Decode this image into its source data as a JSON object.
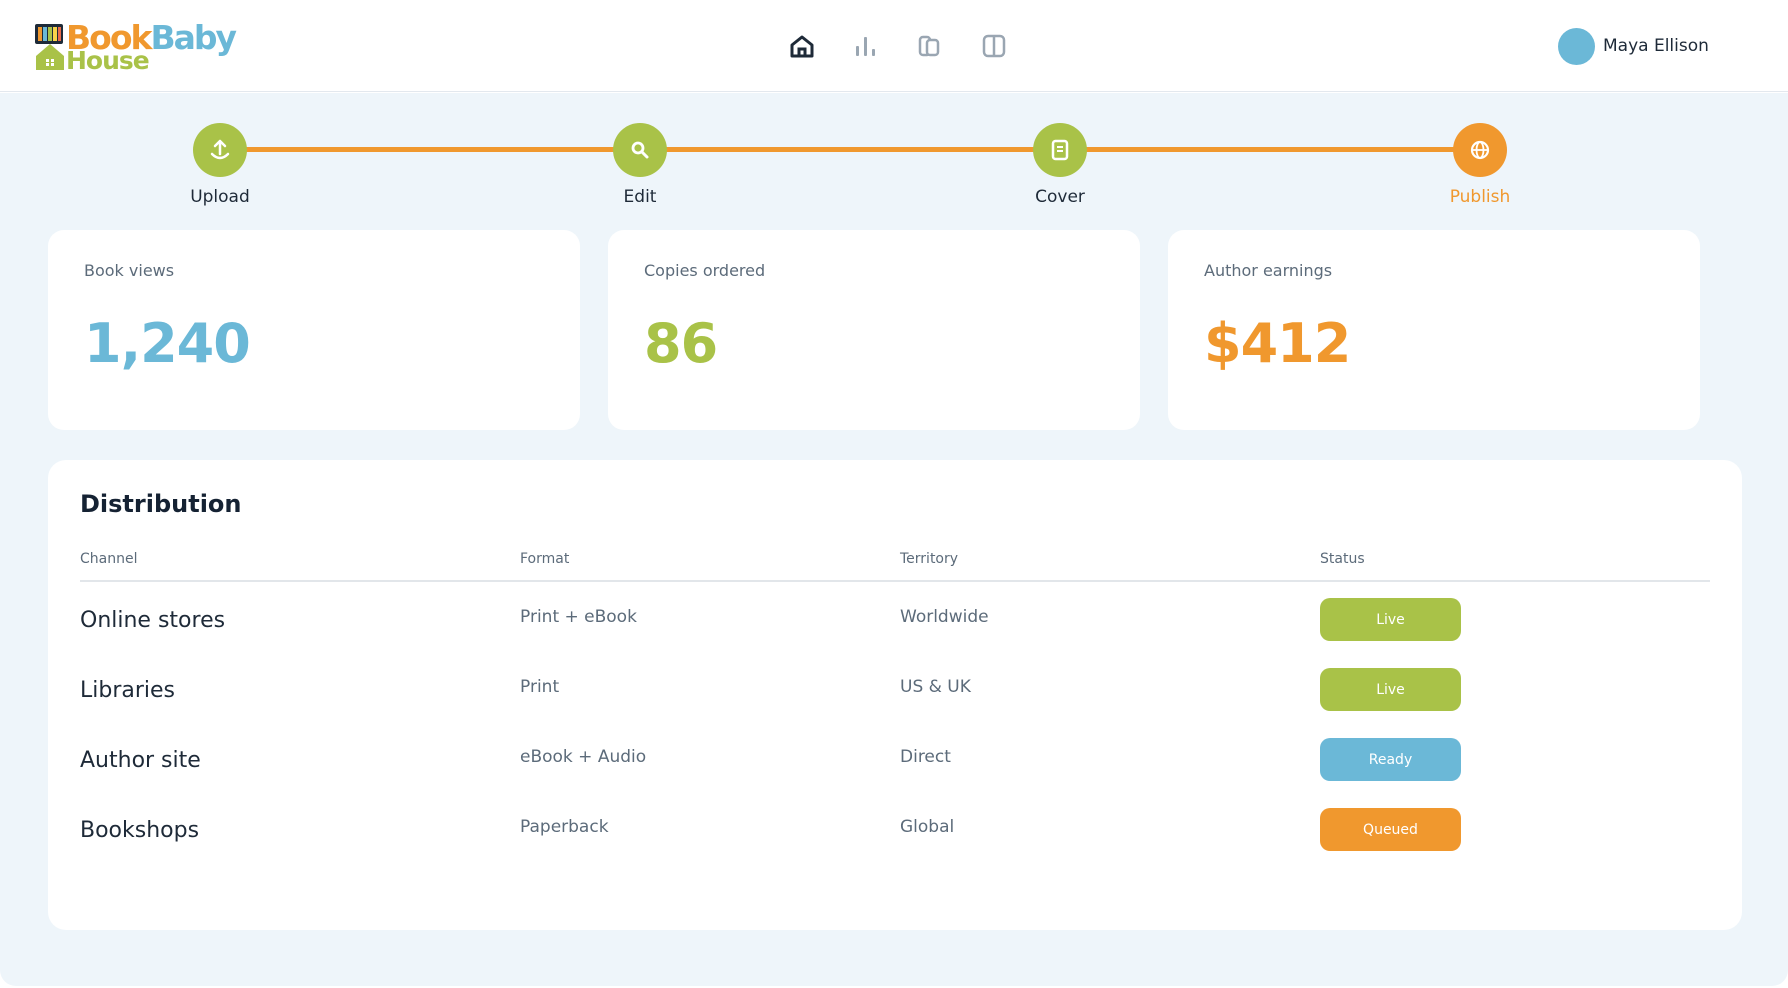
{
  "brand": {
    "logo_book": "Book",
    "logo_baby": "Baby",
    "logo_house": "House"
  },
  "nav": {
    "items": [
      {
        "icon": "home-icon",
        "active": true
      },
      {
        "icon": "bar-chart-icon",
        "active": false
      },
      {
        "icon": "library-icon",
        "active": false
      },
      {
        "icon": "book-open-icon",
        "active": false
      }
    ]
  },
  "user": {
    "name": "Maya Ellison"
  },
  "stepper": {
    "steps": [
      {
        "label": "Upload",
        "icon": "upload-icon",
        "color": "#a9c248"
      },
      {
        "label": "Edit",
        "icon": "search-icon",
        "color": "#a9c248"
      },
      {
        "label": "Cover",
        "icon": "document-icon",
        "color": "#a9c248"
      },
      {
        "label": "Publish",
        "icon": "globe-icon",
        "color": "#f0982e",
        "active": true
      }
    ]
  },
  "stats": [
    {
      "label": "Book views",
      "value": "1,240",
      "color": "#6bb8d7"
    },
    {
      "label": "Copies ordered",
      "value": "86",
      "color": "#a9c248"
    },
    {
      "label": "Author earnings",
      "value": "$412",
      "color": "#f0982e"
    }
  ],
  "distribution": {
    "title": "Distribution",
    "columns": [
      "Channel",
      "Format",
      "Territory",
      "Status"
    ],
    "rows": [
      {
        "channel": "Online stores",
        "format": "Print + eBook",
        "territory": "Worldwide",
        "status": "Live",
        "status_color": "#a9c248"
      },
      {
        "channel": "Libraries",
        "format": "Print",
        "territory": "US & UK",
        "status": "Live",
        "status_color": "#a9c248"
      },
      {
        "channel": "Author site",
        "format": "eBook + Audio",
        "territory": "Direct",
        "status": "Ready",
        "status_color": "#6bb8d7"
      },
      {
        "channel": "Bookshops",
        "format": "Paperback",
        "territory": "Global",
        "status": "Queued",
        "status_color": "#f0982e"
      }
    ]
  },
  "colors": {
    "green": "#a9c248",
    "blue": "#6bb8d7",
    "orange": "#f0982e",
    "background": "#eef5fa"
  }
}
